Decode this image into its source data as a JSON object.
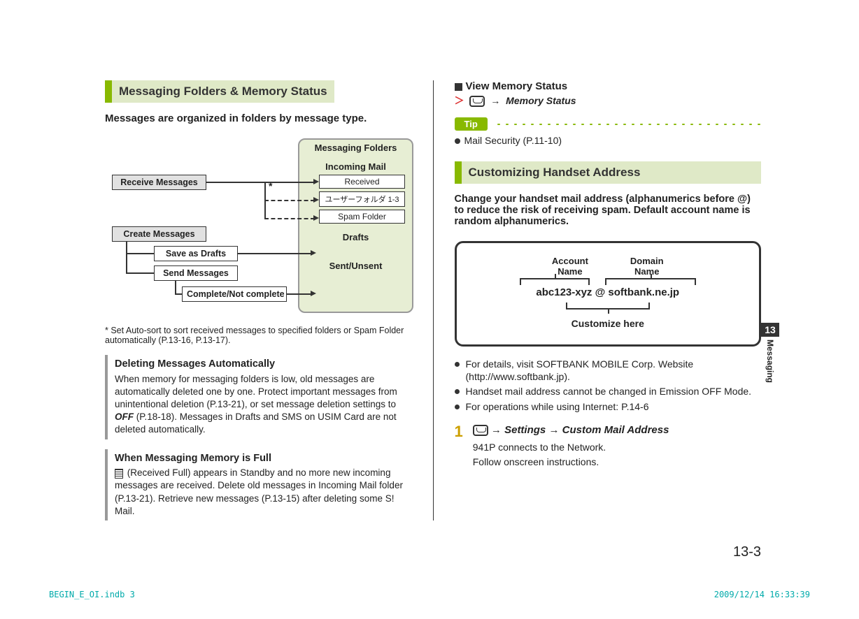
{
  "left": {
    "section_title": "Messaging Folders & Memory Status",
    "intro": "Messages are organized in folders by message type.",
    "diagram": {
      "receive": "Receive Messages",
      "create": "Create Messages",
      "save_drafts": "Save as Drafts",
      "send": "Send Messages",
      "complete": "Complete/Not complete",
      "star": "*",
      "panel_title": "Messaging Folders",
      "incoming": "Incoming Mail",
      "received": "Received",
      "user_folder": "ユーザーフォルダ 1-3",
      "spam": "Spam Folder",
      "drafts": "Drafts",
      "sent": "Sent/Unsent"
    },
    "footnote": "* Set Auto-sort to sort received messages to specified folders or Spam Folder automatically (P.13-16, P.13-17).",
    "aside1": {
      "title": "Deleting Messages Automatically",
      "body_pre": "When memory for messaging folders is low, old messages are automatically deleted one by one. Protect important messages from unintentional deletion (P.13-21), or set message deletion settings to ",
      "off": "OFF",
      "body_post": " (P.18-18). Messages in Drafts and SMS on USIM Card are not deleted automatically."
    },
    "aside2": {
      "title": "When Messaging Memory is Full",
      "body": " (Received Full) appears in Standby and no more new incoming messages are received. Delete old messages in Incoming Mail folder (P.13-21). Retrieve new messages (P.13-15) after deleting some S! Mail."
    }
  },
  "right": {
    "view_mem": "View Memory Status",
    "view_mem_action": "Memory Status",
    "tip_label": "Tip",
    "tip_line": "Mail Security (P.11-10)",
    "section_title": "Customizing Handset Address",
    "intro": "Change your handset mail address (alphanumerics before @) to reduce the risk of receiving spam. Default account name is random alphanumerics.",
    "addr": {
      "account_label": "Account\nName",
      "domain_label": "Domain\nName",
      "value_account": "abc123-xyz",
      "value_at": "@",
      "value_domain": "softbank.ne.jp",
      "customize": "Customize here"
    },
    "bullets": [
      "For details, visit SOFTBANK MOBILE Corp. Website (http://www.softbank.jp).",
      "Handset mail address cannot be changed in Emission OFF Mode.",
      "For operations while using Internet: P.14-6"
    ],
    "step": {
      "num": "1",
      "arrow": "→",
      "settings": "Settings",
      "custom": "Custom Mail Address",
      "line1": "941P connects to the Network.",
      "line2": "Follow onscreen instructions."
    }
  },
  "side_tab": {
    "num": "13",
    "label": "Messaging"
  },
  "page_number": "13-3",
  "footer_left": "BEGIN_E_OI.indb   3",
  "footer_right": "2009/12/14   16:33:39"
}
